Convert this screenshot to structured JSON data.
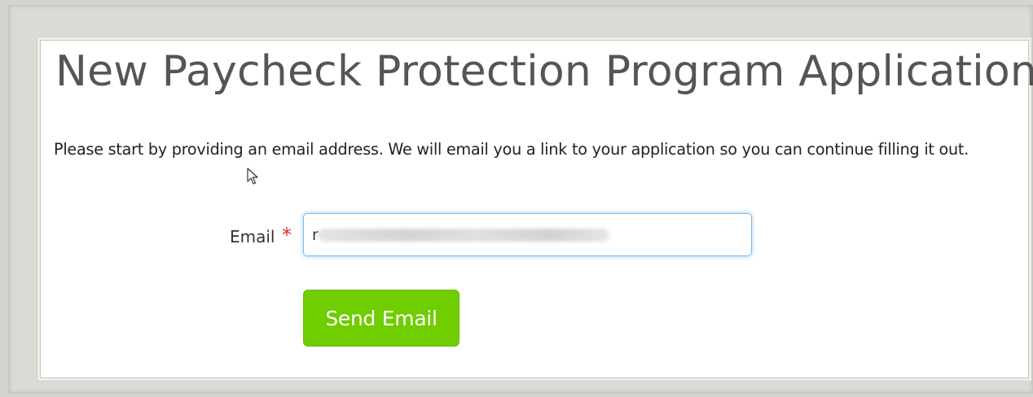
{
  "page": {
    "title": "New Paycheck Protection Program Application",
    "intro": "Please start by providing an email address. We will email you a link to your application so you can continue filling it out."
  },
  "form": {
    "email_label": "Email",
    "required_marker": "*",
    "email_value": "r",
    "send_button_label": "Send Email"
  },
  "colors": {
    "primary_button": "#6fcd00",
    "required": "#d9302c",
    "input_focus": "#7fb7e6"
  },
  "icons": {
    "cursor": "mouse-pointer-icon"
  }
}
